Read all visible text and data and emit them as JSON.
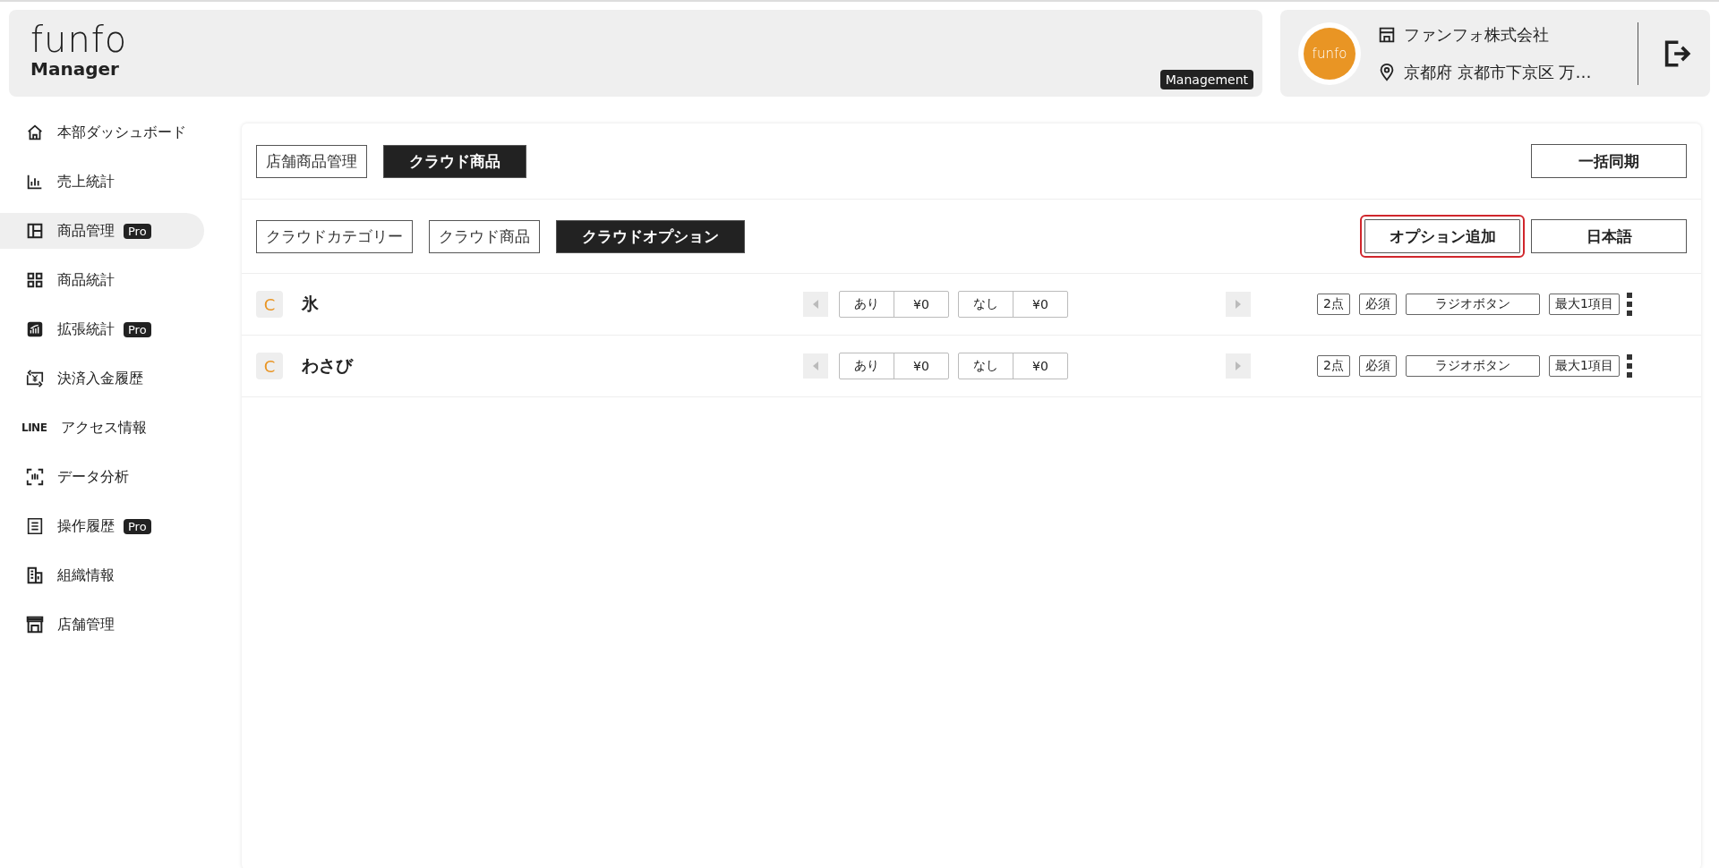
{
  "header": {
    "logo": "funfo",
    "subtitle": "Manager",
    "mode_badge": "Management",
    "store_avatar": "funfo",
    "company": "ファンフォ株式会社",
    "address": "京都府 京都市下京区 万…"
  },
  "sidebar": {
    "items": [
      {
        "label": "本部ダッシュボード",
        "selected": false
      },
      {
        "label": "売上統計",
        "selected": false
      },
      {
        "label": "商品管理",
        "selected": true,
        "badge": "Pro"
      },
      {
        "label": "商品統計",
        "selected": false
      },
      {
        "label": "拡張統計",
        "selected": false,
        "badge": "Pro"
      },
      {
        "label": "決済入金履歴",
        "selected": false
      },
      {
        "label": "アクセス情報",
        "selected": false,
        "icon_text": "LINE"
      },
      {
        "label": "データ分析",
        "selected": false
      },
      {
        "label": "操作履歴",
        "selected": false,
        "badge": "Pro"
      },
      {
        "label": "組織情報",
        "selected": false
      },
      {
        "label": "店舗管理",
        "selected": false
      }
    ]
  },
  "top_tabs": [
    {
      "label": "店舗商品管理",
      "selected": false
    },
    {
      "label": "クラウド商品",
      "selected": true
    }
  ],
  "sync_button": "一括同期",
  "sub_tabs": [
    {
      "label": "クラウドカテゴリー",
      "selected": false
    },
    {
      "label": "クラウド商品",
      "selected": false
    },
    {
      "label": "クラウドオプション",
      "selected": true
    }
  ],
  "add_option_button": {
    "label": "オプション追加",
    "highlighted": true
  },
  "language_button": "日本語",
  "options": [
    {
      "badge": "C",
      "name": "氷",
      "choices": [
        {
          "label": "あり",
          "price": "¥0"
        },
        {
          "label": "なし",
          "price": "¥0"
        }
      ],
      "count": "2点",
      "required": "必須",
      "type": "ラジオボタン",
      "max": "最大1項目"
    },
    {
      "badge": "C",
      "name": "わさび",
      "choices": [
        {
          "label": "あり",
          "price": "¥0"
        },
        {
          "label": "なし",
          "price": "¥0"
        }
      ],
      "count": "2点",
      "required": "必須",
      "type": "ラジオボタン",
      "max": "最大1項目"
    }
  ]
}
